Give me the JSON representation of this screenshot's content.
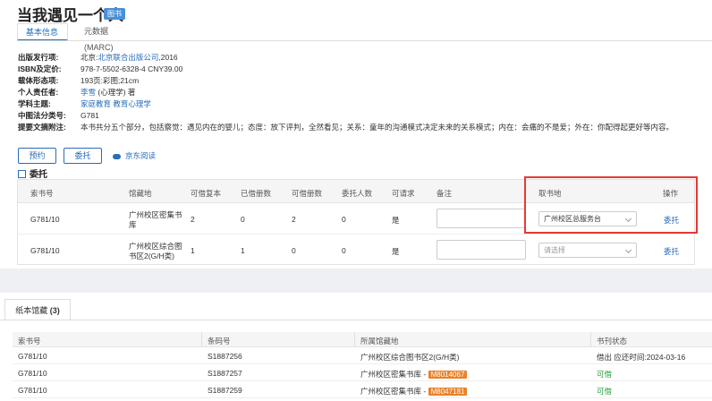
{
  "book": {
    "title": "当我遇见一个人",
    "badge": "图书"
  },
  "tabs": [
    {
      "label": "基本信息",
      "active": true
    },
    {
      "label": "元数据(MARC)",
      "active": false
    }
  ],
  "metadata": {
    "publish_key": "出版发行项:",
    "publish_place": "北京:",
    "publisher": "北京联合出版公司",
    "publish_year": ",2016",
    "isbn_key": "ISBN及定价:",
    "isbn_value": "978-7-5502-6328-4 CNY39.00",
    "physical_key": "载体形态项:",
    "physical_value": "193页:彩图;21cm",
    "author_key": "个人责任者:",
    "author_name": "李雪",
    "author_suffix": " (心理学) 著",
    "subject_key": "学科主题:",
    "subject_1": "家庭教育",
    "subject_2": "教育心理学",
    "clc_key": "中图法分类号:",
    "clc_value": "G781",
    "summary_key": "提要文摘附注:",
    "summary_value": "本书共分五个部分，包括察觉：遇见内在的婴儿；态度：放下评判，全然看见；关系：童年的沟通模式决定未来的关系模式；内在：会痛的不是爱；外在：你配得起更好等内容。"
  },
  "actions": {
    "reserve": "预约",
    "delegate": "委托",
    "jd_read": "京东阅读"
  },
  "delegate_section": {
    "title": "委托",
    "columns": [
      "索书号",
      "馆藏地",
      "可借复本",
      "已借册数",
      "可借册数",
      "委托人数",
      "可请求",
      "备注",
      "取书地",
      "操作"
    ],
    "rows": [
      {
        "call_no": "G781/10",
        "location_l1": "广州校区密集书",
        "location_l2": "库",
        "available_copies": "2",
        "borrowed": "0",
        "borrowable": "2",
        "delegates": "0",
        "requestable": "是",
        "pickup": "广州校区总服务台",
        "action": "委托"
      },
      {
        "call_no": "G781/10",
        "location_l1": "广州校区综合图",
        "location_l2": "书区2(G/H类)",
        "available_copies": "1",
        "borrowed": "1",
        "borrowable": "0",
        "delegates": "0",
        "requestable": "是",
        "pickup": "请选择",
        "action": "委托"
      }
    ]
  },
  "holdings": {
    "tab_label": "纸本馆藏",
    "tab_count": "(3)",
    "columns": [
      "索书号",
      "条码号",
      "所属馆藏地",
      "书刊状态"
    ],
    "rows": [
      {
        "call_no": "G781/10",
        "barcode": "S1887256",
        "location": "广州校区综合图书区2(G/H类)",
        "tag": "",
        "status": "借出 应还时间:2024-03-16",
        "status_green": false
      },
      {
        "call_no": "G781/10",
        "barcode": "S1887257",
        "location": "广州校区密集书库 -",
        "tag": "M8014067",
        "status": "可借",
        "status_green": true
      },
      {
        "call_no": "G781/10",
        "barcode": "S1887259",
        "location": "广州校区密集书库 -",
        "tag": "M8047181",
        "status": "可借",
        "status_green": true
      }
    ]
  },
  "colors": {
    "accent": "#2a6db8",
    "highlight_border": "#e53935",
    "tag": "#e8822c",
    "available": "#27a13a"
  }
}
